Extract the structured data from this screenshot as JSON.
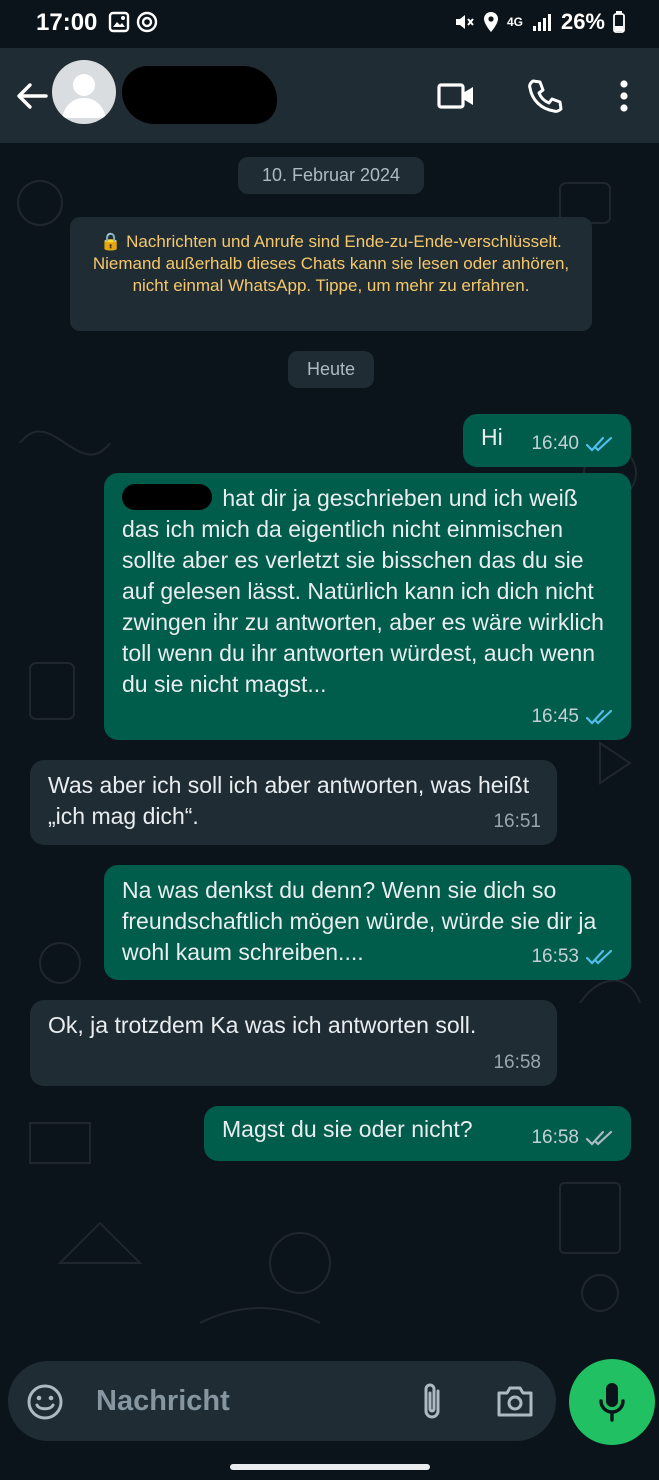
{
  "status_bar": {
    "time": "17:00",
    "signal": "4G",
    "battery": "26%"
  },
  "header": {
    "contact_name_redacted": true
  },
  "chat": {
    "date_divider": "10. Februar 2024",
    "encryption_notice": "🔒 Nachrichten und Anrufe sind Ende-zu-Ende-verschlüsselt. Niemand außerhalb dieses Chats kann sie lesen oder anhören, nicht einmal WhatsApp. Tippe, um mehr zu erfahren.",
    "today_divider": "Heute",
    "messages": [
      {
        "direction": "out",
        "text": "Hi",
        "time": "16:40",
        "read": true
      },
      {
        "direction": "out",
        "text": " hat dir ja geschrieben und ich weiß das ich mich da eigentlich nicht einmischen sollte aber es verletzt sie bisschen das du sie auf gelesen lässt. Natürlich kann ich dich nicht zwingen ihr zu antworten, aber es wäre wirklich toll wenn du ihr antworten würdest, auch wenn du sie nicht magst...",
        "time": "16:45",
        "read": true
      },
      {
        "direction": "in",
        "text": "Was aber ich soll ich aber antworten, was heißt „ich mag dich“.",
        "time": "16:51"
      },
      {
        "direction": "out",
        "text": "Na was denkst du denn? Wenn sie dich so freundschaftlich mögen würde, würde sie dir ja wohl kaum schreiben....",
        "time": "16:53",
        "read": true
      },
      {
        "direction": "in",
        "text": "Ok, ja  trotzdem Ka was ich antworten soll.",
        "time": "16:58"
      },
      {
        "direction": "out",
        "text": "Magst du sie oder nicht?",
        "time": "16:58",
        "read": false
      }
    ]
  },
  "input": {
    "placeholder": "Nachricht"
  },
  "colors": {
    "accent": "#21c063",
    "outgoing": "#005c4b",
    "incoming": "#1f2c34",
    "read_ticks": "#53bdeb"
  }
}
